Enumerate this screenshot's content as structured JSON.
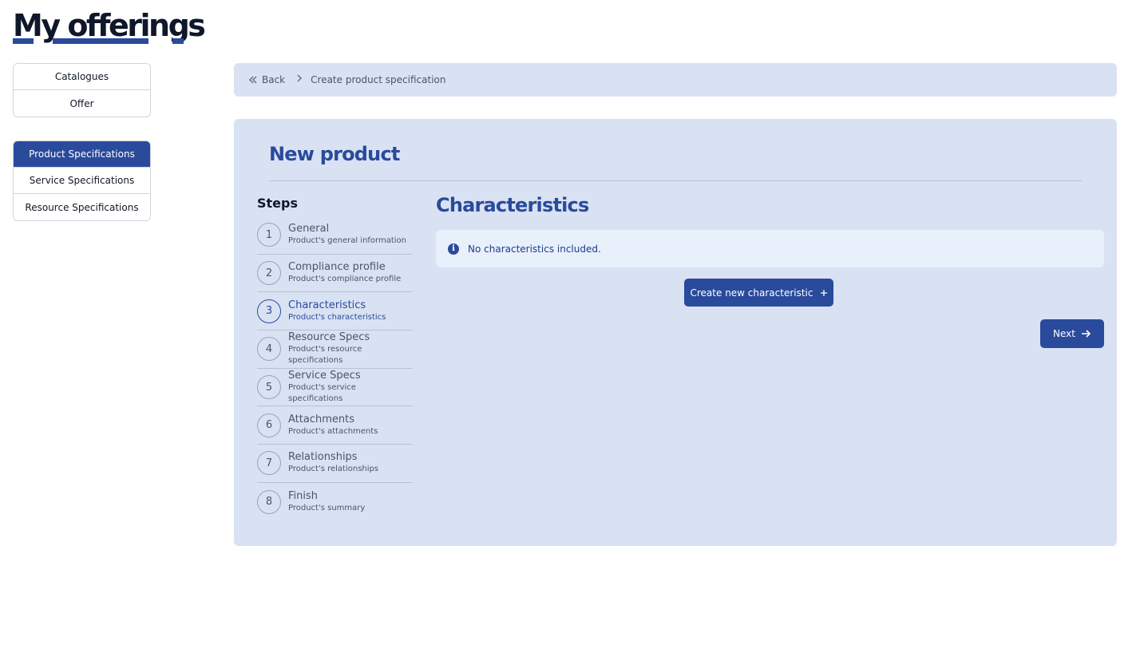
{
  "header": {
    "title": "My offerings"
  },
  "nav": {
    "top_menu": [
      {
        "label": "Catalogues"
      },
      {
        "label": "Offer"
      }
    ],
    "spec_menu": [
      {
        "label": "Product Specifications",
        "active": true
      },
      {
        "label": "Service Specifications",
        "active": false
      },
      {
        "label": "Resource Specifications",
        "active": false
      }
    ]
  },
  "breadcrumb": {
    "back_label": "Back",
    "current": "Create product specification"
  },
  "panel": {
    "title": "New product",
    "steps_heading": "Steps",
    "steps": [
      {
        "num": "1",
        "name": "General",
        "desc": "Product's general information"
      },
      {
        "num": "2",
        "name": "Compliance profile",
        "desc": "Product's compliance profile"
      },
      {
        "num": "3",
        "name": "Characteristics",
        "desc": "Product's characteristics",
        "active": true
      },
      {
        "num": "4",
        "name": "Resource Specs",
        "desc": "Product's resource specifications"
      },
      {
        "num": "5",
        "name": "Service Specs",
        "desc": "Product's service specifications"
      },
      {
        "num": "6",
        "name": "Attachments",
        "desc": "Product's attachments"
      },
      {
        "num": "7",
        "name": "Relationships",
        "desc": "Product's relationships"
      },
      {
        "num": "8",
        "name": "Finish",
        "desc": "Product's summary"
      }
    ],
    "section_title": "Characteristics",
    "info_message": "No characteristics included.",
    "create_button": "Create new characteristic",
    "next_button": "Next"
  },
  "colors": {
    "accent": "#2a4a9b",
    "panel_bg": "#d9e2f3",
    "info_bg": "#e8f0fc"
  },
  "icons": {
    "back": "double-chevron-left-icon",
    "separator": "chevron-right-icon",
    "info": "info-circle-icon",
    "plus": "plus-icon",
    "next": "arrow-right-icon"
  }
}
